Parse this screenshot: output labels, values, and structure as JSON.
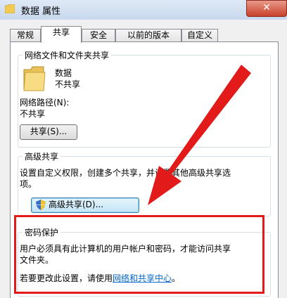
{
  "window": {
    "title": "数据 属性",
    "close_glyph": "✕"
  },
  "tabs": [
    "常规",
    "共享",
    "安全",
    "以前的版本",
    "自定义"
  ],
  "network_share": {
    "group_title": "网络文件和文件夹共享",
    "folder_name": "数据",
    "folder_status": "不共享",
    "path_label": "网络路径(N):",
    "path_value": "不共享",
    "share_button": "共享(S)..."
  },
  "advanced_share": {
    "group_title": "高级共享",
    "description_line1": "设置自定义权限，创建多个共享，并设置其他高级共享选",
    "description_line2": "项。",
    "button": "高级共享(D)..."
  },
  "password": {
    "group_title": "密码保护",
    "line1": "用户必须具有此计算机的用户帐户和密码，才能访问共享",
    "line2": "文件夹。",
    "change_prefix": "若要更改此设置，请使用",
    "link_text": "网络和共享中心",
    "change_suffix": "。"
  },
  "colors": {
    "annotation_red": "#e21a1a",
    "link_blue": "#0066cc",
    "folder_yellow": "#f4d36b"
  },
  "icons": [
    "folder-icon",
    "shield-icon",
    "close-icon",
    "red-arrow"
  ]
}
